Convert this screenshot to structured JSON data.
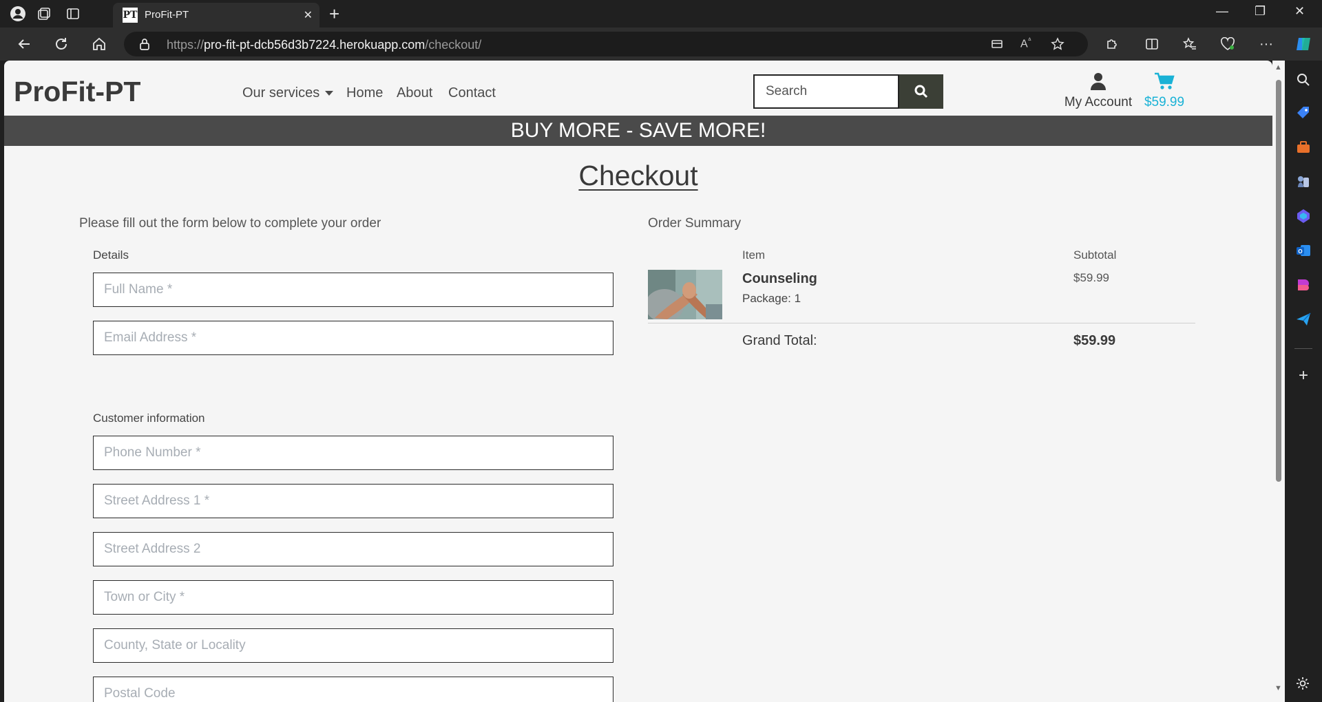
{
  "browser": {
    "tab_title": "ProFit-PT",
    "tab_favicon_text": "PT",
    "url_prefix": "https://",
    "url_host": "pro-fit-pt-dcb56d3b7224.herokuapp.com",
    "url_path": "/checkout/",
    "icons": {
      "profile": "profile-icon",
      "workspaces": "workspaces-icon",
      "tab_actions": "tab-actions-icon",
      "back": "back-icon",
      "refresh": "refresh-icon",
      "home": "home-icon",
      "lock": "lock-icon",
      "immersive_reader": "immersive-reader-icon",
      "read_aloud": "read-aloud-icon",
      "favorite": "star-icon",
      "extensions": "extensions-icon",
      "split_screen": "split-screen-icon",
      "favorites": "favorites-icon",
      "browser_essentials": "heart-pulse-icon",
      "more": "more-icon",
      "copilot": "copilot-icon"
    }
  },
  "header": {
    "brand": "ProFit-PT",
    "nav": {
      "services": "Our services",
      "home": "Home",
      "about": "About",
      "contact": "Contact"
    },
    "search_placeholder": "Search",
    "account_label": "My Account",
    "cart_total": "$59.99"
  },
  "banner": "BUY MORE - SAVE MORE!",
  "page_title": "Checkout",
  "form": {
    "intro": "Please fill out the form below to complete your order",
    "details_label": "Details",
    "full_name_placeholder": "Full Name *",
    "email_placeholder": "Email Address *",
    "customer_info_label": "Customer information",
    "phone_placeholder": "Phone Number *",
    "street1_placeholder": "Street Address 1 *",
    "street2_placeholder": "Street Address 2",
    "town_placeholder": "Town or City *",
    "county_placeholder": "County, State or Locality",
    "postcode_placeholder": "Postal Code"
  },
  "order_summary": {
    "title": "Order Summary",
    "item_header": "Item",
    "subtotal_header": "Subtotal",
    "item_name": "Counseling",
    "item_package": "Package: 1",
    "item_subtotal": "$59.99",
    "grand_total_label": "Grand Total:",
    "grand_total_value": "$59.99"
  },
  "colors": {
    "banner_bg": "#4a4a4a",
    "search_button": "#3b3f36",
    "cart_accent": "#1ab2d6",
    "page_bg": "#f5f5f5"
  }
}
